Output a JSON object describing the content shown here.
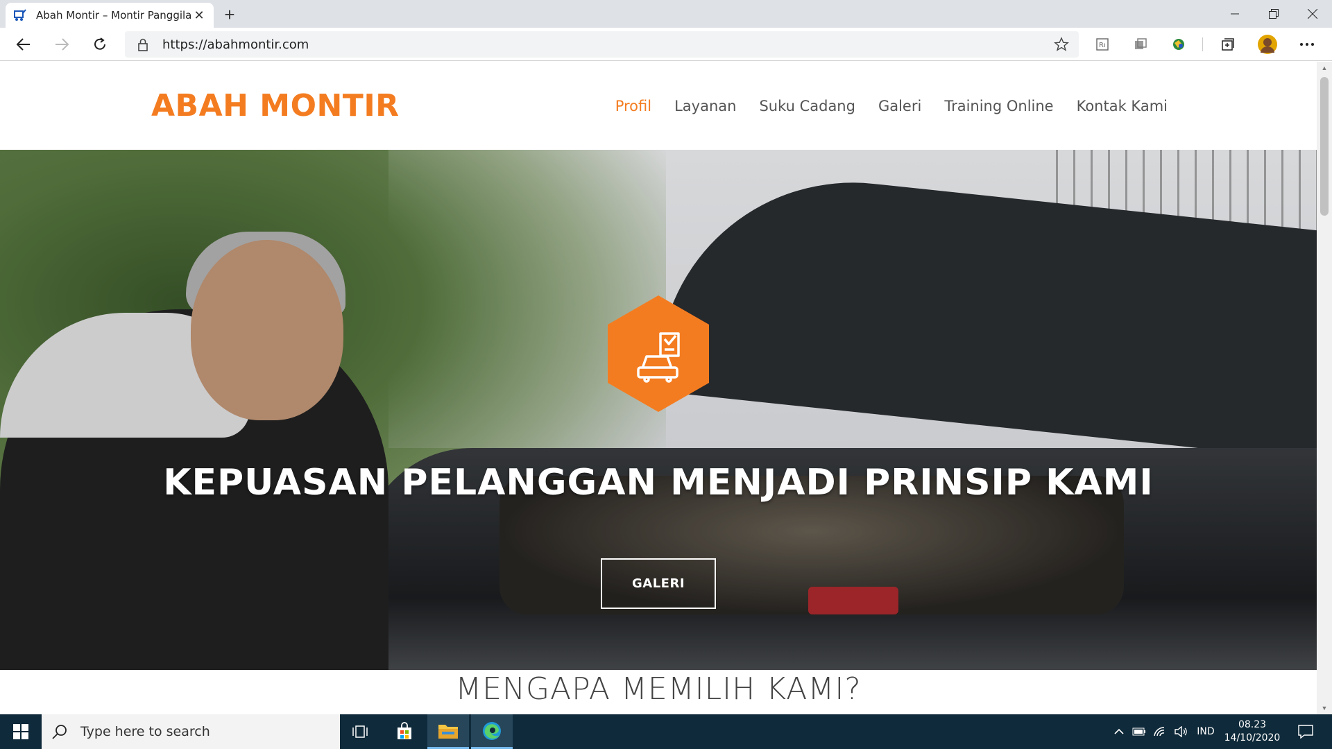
{
  "browser": {
    "tab_title": "Abah Montir – Montir Panggilan",
    "url": "https://abahmontir.com",
    "profile_initial": ""
  },
  "site": {
    "brand": "ABAH MONTIR",
    "nav": [
      {
        "label": "Profil",
        "active": true
      },
      {
        "label": "Layanan",
        "active": false
      },
      {
        "label": "Suku Cadang",
        "active": false
      },
      {
        "label": "Galeri",
        "active": false
      },
      {
        "label": "Training Online",
        "active": false
      },
      {
        "label": "Kontak Kami",
        "active": false
      }
    ],
    "hero": {
      "icon": "car-checklist-icon",
      "title": "KEPUASAN PELANGGAN MENJADI PRINSIP KAMI",
      "button_label": "GALERI"
    },
    "section_title": "MENGAPA MEMILIH KAMI?"
  },
  "taskbar": {
    "search_placeholder": "Type here to search",
    "language": "IND",
    "time": "08.23",
    "date": "14/10/2020"
  },
  "colors": {
    "accent": "#f47c20",
    "taskbar": "#0f2a3a"
  }
}
